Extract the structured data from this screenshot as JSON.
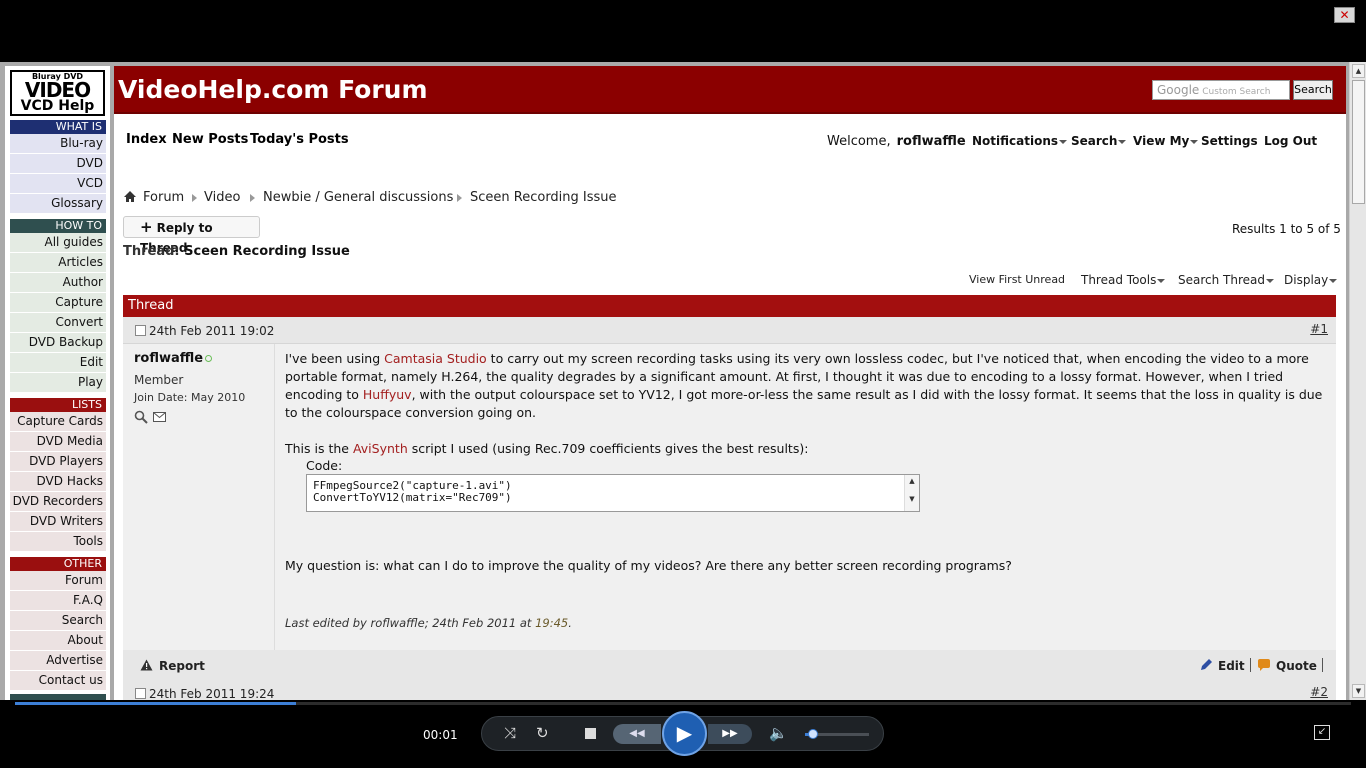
{
  "window": {
    "close_label": "✕"
  },
  "sidebar": {
    "logo": {
      "line1": "Bluray DVD",
      "line2": "VIDEO",
      "line3": "VCD Help"
    },
    "sections": [
      {
        "title": "WHAT IS",
        "items": [
          "Blu-ray",
          "DVD",
          "VCD",
          "Glossary"
        ]
      },
      {
        "title": "HOW TO",
        "items": [
          "All guides",
          "Articles",
          "Author",
          "Capture",
          "Convert",
          "DVD Backup",
          "Edit",
          "Play"
        ]
      },
      {
        "title": "LISTS",
        "items": [
          "Capture Cards",
          "DVD Media",
          "DVD Players",
          "DVD Hacks",
          "DVD Recorders",
          "DVD Writers",
          "Tools"
        ]
      },
      {
        "title": "OTHER",
        "items": [
          "Forum",
          "F.A.Q",
          "Search",
          "About",
          "Advertise",
          "Contact us"
        ]
      }
    ]
  },
  "header": {
    "title": "VideoHelp.com Forum",
    "search_placeholder": "Custom Search",
    "search_brand": "Google",
    "search_button": "Search"
  },
  "topnav": {
    "links": [
      "Index",
      "New Posts",
      "Today's Posts"
    ],
    "welcome": "Welcome,",
    "username": "roflwaffle",
    "right_links": [
      "Notifications",
      "Search",
      "View My",
      "Settings",
      "Log Out"
    ]
  },
  "breadcrumb": [
    "Forum",
    "Video",
    "Newbie / General discussions",
    "Sceen Recording Issue"
  ],
  "thread": {
    "reply_button": "Reply to Thread",
    "results": "Results 1 to 5 of 5",
    "title_prefix": "Thread:",
    "title": "Sceen Recording Issue",
    "tools": [
      "View First Unread",
      "Thread Tools",
      "Search Thread",
      "Display"
    ],
    "bar_label": "Thread"
  },
  "post": {
    "date": "24th Feb 2011 19:02",
    "number": "#1",
    "author": "roflwaffle",
    "rank": "Member",
    "join_date": "Join Date: May 2010",
    "para1_a": "I've been using ",
    "link_camtasia": "Camtasia Studio",
    "para1_b": " to carry out my screen recording tasks using its very own lossless codec, but I've noticed that, when encoding the video to a more portable format, namely H.264, the quality degrades by a significant amount. At first, I thought it was due to encoding to a lossy format. However, when I tried encoding to ",
    "link_huffyuv": "Huffyuv",
    "para1_c": ", with the output colourspace set to YV12, I got more-or-less the same result as I did with the lossy format. It seems that the loss in quality is due to the colourspace conversion going on.",
    "para2_a": "This is the ",
    "link_avisynth": "AviSynth",
    "para2_b": " script I used (using Rec.709 coefficients gives the best results):",
    "code_label": "Code:",
    "code": "FFmpegSource2(\"capture-1.avi\")\nConvertToYV12(matrix=\"Rec709\")",
    "para3": "My question is: what can I do to improve the quality of my videos? Are there any better screen recording programs?",
    "last_edited_text": "Last edited by roflwaffle; 24th Feb 2011 at ",
    "last_edited_time": "19:45",
    "last_edited_end": ".",
    "report": "Report",
    "edit": "Edit",
    "quote": "Quote"
  },
  "post2": {
    "date": "24th Feb 2011 19:24",
    "number": "#2"
  },
  "player": {
    "time": "00:01",
    "progress": 0.21,
    "volume": 0.12
  }
}
